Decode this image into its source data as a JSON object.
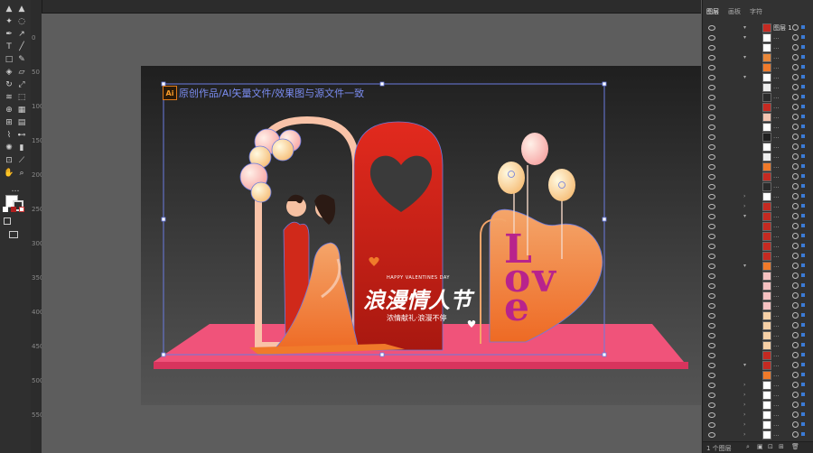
{
  "panel": {
    "tabs": [
      {
        "label": "图层"
      },
      {
        "label": "画板"
      },
      {
        "label": "字符"
      }
    ],
    "top_layer_label": "图层 1",
    "bottom_status": "1 个图层",
    "dots": "..."
  },
  "artboard": {
    "ai_badge": "Ai",
    "header_text": "原创作品/AI矢量文件/效果图与源文件一致",
    "love_text": "Love",
    "happy_text": "HAPPY VALENTINES DAY",
    "main_title": "浪漫情人节",
    "sub_title": "浓情献礼·浪漫不停"
  },
  "rulers": {
    "left_labels": [
      "0",
      "50",
      "100",
      "150",
      "200",
      "250",
      "300",
      "350",
      "400",
      "450",
      "500",
      "550"
    ]
  },
  "colors": {
    "panel_bg": "#323232",
    "canvas_bg": "#5d5d5d",
    "accent_blue": "#5a78d6",
    "red": "#d22a1e",
    "orange": "#f07a2a",
    "pink": "#f56a8a"
  }
}
